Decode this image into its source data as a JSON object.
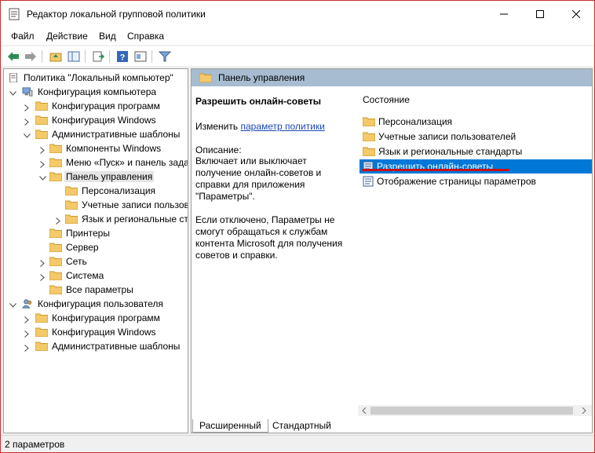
{
  "window": {
    "title": "Редактор локальной групповой политики"
  },
  "menu": [
    "Файл",
    "Действие",
    "Вид",
    "Справка"
  ],
  "tree": [
    {
      "label": "Политика \"Локальный компьютер\""
    },
    {
      "label": "Конфигурация компьютера"
    },
    {
      "label": "Конфигурация программ"
    },
    {
      "label": "Конфигурация Windows"
    },
    {
      "label": "Административные шаблоны"
    },
    {
      "label": "Компоненты Windows"
    },
    {
      "label": "Меню «Пуск» и панель задач"
    },
    {
      "label": "Панель управления"
    },
    {
      "label": "Персонализация"
    },
    {
      "label": "Учетные записи пользователей"
    },
    {
      "label": "Язык и региональные стандарты"
    },
    {
      "label": "Принтеры"
    },
    {
      "label": "Сервер"
    },
    {
      "label": "Сеть"
    },
    {
      "label": "Система"
    },
    {
      "label": "Все параметры"
    },
    {
      "label": "Конфигурация пользователя"
    },
    {
      "label": "Конфигурация программ"
    },
    {
      "label": "Конфигурация Windows"
    },
    {
      "label": "Административные шаблоны"
    }
  ],
  "right": {
    "header": "Панель управления",
    "extended": {
      "title": "Разрешить онлайн-советы",
      "edit_prefix": "Изменить ",
      "edit_link": "параметр политики",
      "desc_label": "Описание:",
      "desc": "Включает или выключает получение онлайн-советов и справки для приложения \"Параметры\".",
      "desc2": "Если отключено, Параметры не смогут обращаться к службам контента Microsoft для получения советов и справки."
    },
    "list_header": "Состояние",
    "list": [
      {
        "label": "Персонализация",
        "icon": "folder-icon"
      },
      {
        "label": "Учетные записи пользователей",
        "icon": "folder-icon"
      },
      {
        "label": "Язык и региональные стандарты",
        "icon": "folder-icon"
      },
      {
        "label": "Разрешить онлайн-советы",
        "icon": "policy-setting-icon",
        "selected": true
      },
      {
        "label": "Отображение страницы параметров",
        "icon": "policy-setting-icon"
      }
    ]
  },
  "tabs": [
    "Расширенный",
    "Стандартный"
  ],
  "status": "2 параметров",
  "colors": {
    "selection": "#0078d7",
    "header": "#a7bcd0",
    "folder": "#f3c969",
    "accent_red": "#c4121a"
  }
}
